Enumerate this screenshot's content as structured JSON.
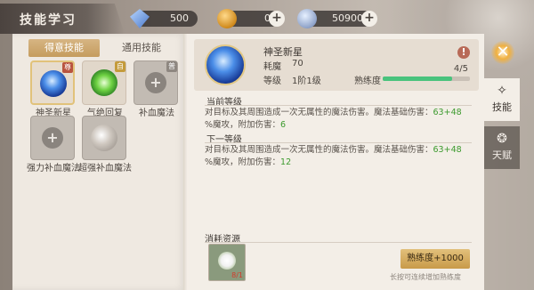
{
  "header": {
    "title": "技能学习",
    "resources": [
      {
        "icon": "diamond-icon",
        "value": "500"
      },
      {
        "icon": "gold-coin-icon",
        "value": "0"
      },
      {
        "icon": "silver-coin-icon",
        "value": "50900"
      }
    ]
  },
  "left_tabs": [
    "得意技能",
    "通用技能"
  ],
  "skills": [
    {
      "name": "神圣新星",
      "badge": "尊",
      "icon": "holy-nova-icon",
      "selected": true
    },
    {
      "name": "气绝回复",
      "badge": "自",
      "icon": "recovery-icon"
    },
    {
      "name": "补血魔法",
      "badge": "普",
      "icon": "heal-magic-icon",
      "locked": true
    },
    {
      "name": "强力补血魔法",
      "icon": "strong-heal-icon",
      "locked": true
    },
    {
      "name": "超强补血魔法",
      "icon": "super-heal-icon",
      "locked": true
    }
  ],
  "detail": {
    "name": "神圣新星",
    "cost_label": "耗魔",
    "cost_value": "70",
    "level_label": "等级",
    "level_value": "1阶1级",
    "proficiency_label": "熟练度",
    "proficiency_count": "4/5",
    "proficiency_progress": 0.8,
    "current_title": "当前等级",
    "current_desc_a": "对目标及其周围造成一次无属性的魔法伤害。魔法基础伤害：",
    "current_desc_b": "63+48",
    "current_desc_c": "%魔攻，附加伤害：",
    "current_desc_d": "6",
    "next_title": "下一等级",
    "next_desc_a": "对目标及其周围造成一次无属性的魔法伤害。魔法基础伤害：",
    "next_desc_b": "63+48",
    "next_desc_c": "%魔攻，附加伤害：",
    "next_desc_d": "12"
  },
  "consume": {
    "title": "消耗资源",
    "item_icon": "white-flower-icon",
    "item_count": "8/1",
    "button": "熟练度+1000",
    "hint": "长按可连续增加熟练度"
  },
  "side_tabs": [
    {
      "label": "技能",
      "icon": "skill-icon"
    },
    {
      "label": "天赋",
      "icon": "talent-icon"
    }
  ]
}
